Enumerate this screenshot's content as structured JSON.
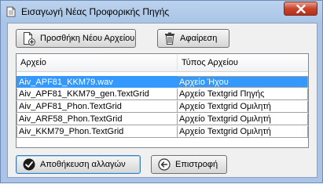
{
  "window": {
    "title": "Εισαγωγή Νέας Προφορικής Πηγής"
  },
  "toolbar": {
    "add_label": "Προσθήκη Νέου Αρχείου",
    "remove_label": "Αφαίρεση"
  },
  "table": {
    "columns": [
      "Αρχείο",
      "Τύπος Αρχείου"
    ],
    "rows": [
      {
        "file": "Aiv_APF81_KKM79.wav",
        "type": "Αρχείο Ήχου",
        "selected": true
      },
      {
        "file": "Aiv_APF81_KKM79_gen.TextGrid",
        "type": "Αρχείο Textgrid Πηγής",
        "selected": false
      },
      {
        "file": "Aiv_APF81_Phon.TextGrid",
        "type": "Αρχείο Textgrid Ομιλητή",
        "selected": false
      },
      {
        "file": "Aiv_ARF58_Phon.TextGrid",
        "type": "Αρχείο Textgrid Ομιλητή",
        "selected": false
      },
      {
        "file": "Aiv_KKM79_Phon.TextGrid",
        "type": "Αρχείο Textgrid Ομιλητή",
        "selected": false
      }
    ]
  },
  "footer": {
    "save_label": "Αποθήκευση αλλαγών",
    "back_label": "Επιστροφή"
  },
  "icons": {
    "window": "document-icon",
    "close": "close-icon",
    "add": "add-file-icon",
    "remove": "trash-icon",
    "save": "checkmark-icon",
    "back": "back-arrow-icon"
  },
  "colors": {
    "selection": "#3399ff",
    "close_button": "#c7432c",
    "frame": "#a9c4e6"
  }
}
